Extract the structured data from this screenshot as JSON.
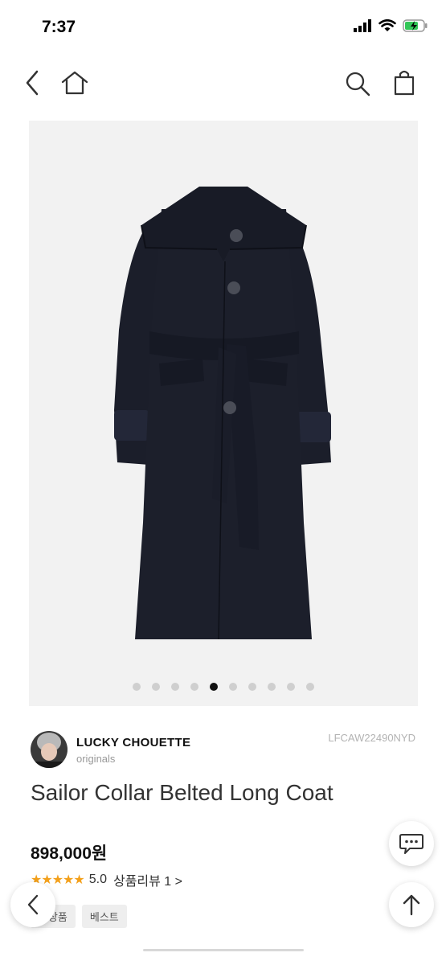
{
  "status_bar": {
    "time": "7:37"
  },
  "header": {
    "back_icon": "chevron-left-icon",
    "home_icon": "home-icon",
    "search_icon": "search-icon",
    "bag_icon": "shopping-bag-icon"
  },
  "gallery": {
    "total_slides": 10,
    "active_slide": 5
  },
  "brand": {
    "name": "LUCKY CHOUETTE",
    "sub": "originals"
  },
  "product": {
    "sku": "LFCAW22490NYD",
    "title": "Sailor Collar Belted Long Coat",
    "price": "898,000원",
    "rating": "5.0",
    "reviews_label": "상품리뷰 1 >"
  },
  "tags": [
    "신상품",
    "베스트"
  ],
  "fab": {
    "chat_icon": "chat-bubble-icon",
    "back_icon": "chevron-left-icon",
    "top_icon": "arrow-up-icon"
  },
  "colors": {
    "star": "#f3a01b",
    "coat": "#1c1f2b"
  }
}
